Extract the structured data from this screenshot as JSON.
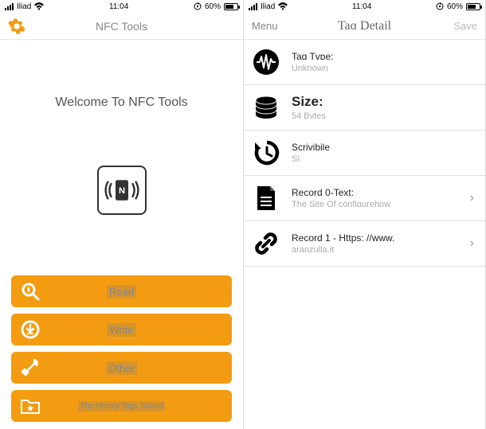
{
  "status": {
    "carrier": "Iliad",
    "time": "11:04",
    "battery_pct": "60%",
    "battery_iconized": "60% ◨"
  },
  "left": {
    "nav_title": "NFC Tools",
    "welcome": "Welcome To NFC Tools",
    "buttons": {
      "read": "Read",
      "write": "Write",
      "other": "Other",
      "saved": "The Honey Tags Saved"
    }
  },
  "right": {
    "nav_left": "Menu",
    "nav_title": "Taɑ Detail",
    "nav_right": "Save",
    "rows": [
      {
        "title": "Taɑ Tvɒe:",
        "sub": "Unknоwn"
      },
      {
        "title": "Size:",
        "sub": "54 Bvtes",
        "big": true
      },
      {
        "title": "Scrivibile",
        "sub": "Sì"
      },
      {
        "title": "Record 0-Text:",
        "sub": "The Site Of confiɑurehow",
        "chevron": true
      },
      {
        "title": "Record 1 - Https: //www.",
        "sub": "aranzulla.it",
        "chevron": true
      }
    ]
  },
  "colors": {
    "accent": "#f39c12"
  }
}
